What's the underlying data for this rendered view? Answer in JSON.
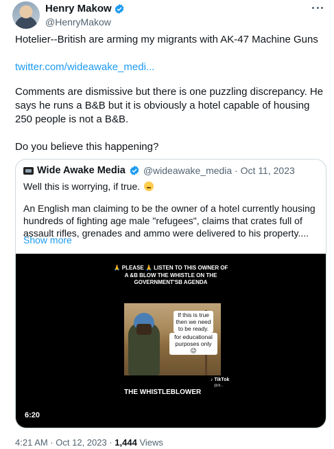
{
  "author": {
    "name": "Henry Makow",
    "handle": "@HenryMakow"
  },
  "tweet": {
    "line1": "Hotelier--British are arming my migrants with AK-47 Machine Guns",
    "link": "twitter.com/wideawake_medi...",
    "para2": "Comments are dismissive but there is one puzzling discrepancy. He says he runs a B&B but it is obviously a hotel capable of housing 250 people is not a B&B.",
    "para3": "Do you believe this happening?"
  },
  "quote": {
    "name": "Wide Awake Media",
    "handle_date": "@wideawake_media · Oct 11, 2023",
    "line1": "Well this is worrying, if true.",
    "line2": "An English man claiming to be the owner of a hotel currently housing hundreds of fighting age male \"refugees\", claims that crates full of assault rifles, grenades and ammo were delivered to his property....",
    "show_more": "Show more"
  },
  "video": {
    "caption": "🙏 PLEASE 🙏 LISTEN TO THIS OWNER OF A &B BLOW THE WHISTLE ON THE GOVERNMENT'SB AGENDA",
    "bubble1": "If this is true then we need to be ready.",
    "bubble2": "for educational purposes only 😉",
    "tiktok": "♪ TikTok",
    "tiktok_handle": "@/d...",
    "title": "THE WHISTLEBLOWER",
    "duration": "6:20"
  },
  "footer": {
    "time_date": "4:21 AM · Oct 12, 2023 ·",
    "views_count": "1,444",
    "views_label": "Views"
  },
  "colors": {
    "link": "#1d9bf0",
    "verified": "#1d9bf0",
    "secondary_text": "#536471"
  }
}
